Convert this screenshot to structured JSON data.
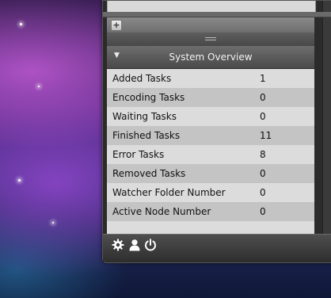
{
  "section": {
    "title": "System Overview",
    "expanded_indicator": "▼"
  },
  "add_button": {
    "label": "+"
  },
  "stats": [
    {
      "label": "Added Tasks",
      "value": "1"
    },
    {
      "label": "Encoding Tasks",
      "value": "0"
    },
    {
      "label": "Waiting Tasks",
      "value": "0"
    },
    {
      "label": "Finished Tasks",
      "value": "11"
    },
    {
      "label": "Error Tasks",
      "value": "8"
    },
    {
      "label": "Removed Tasks",
      "value": "0"
    },
    {
      "label": "Watcher Folder Number",
      "value": "0"
    },
    {
      "label": "Active Node Number",
      "value": "0"
    }
  ],
  "toolbar": {
    "icons": [
      "gear-icon",
      "user-icon",
      "power-icon"
    ]
  }
}
